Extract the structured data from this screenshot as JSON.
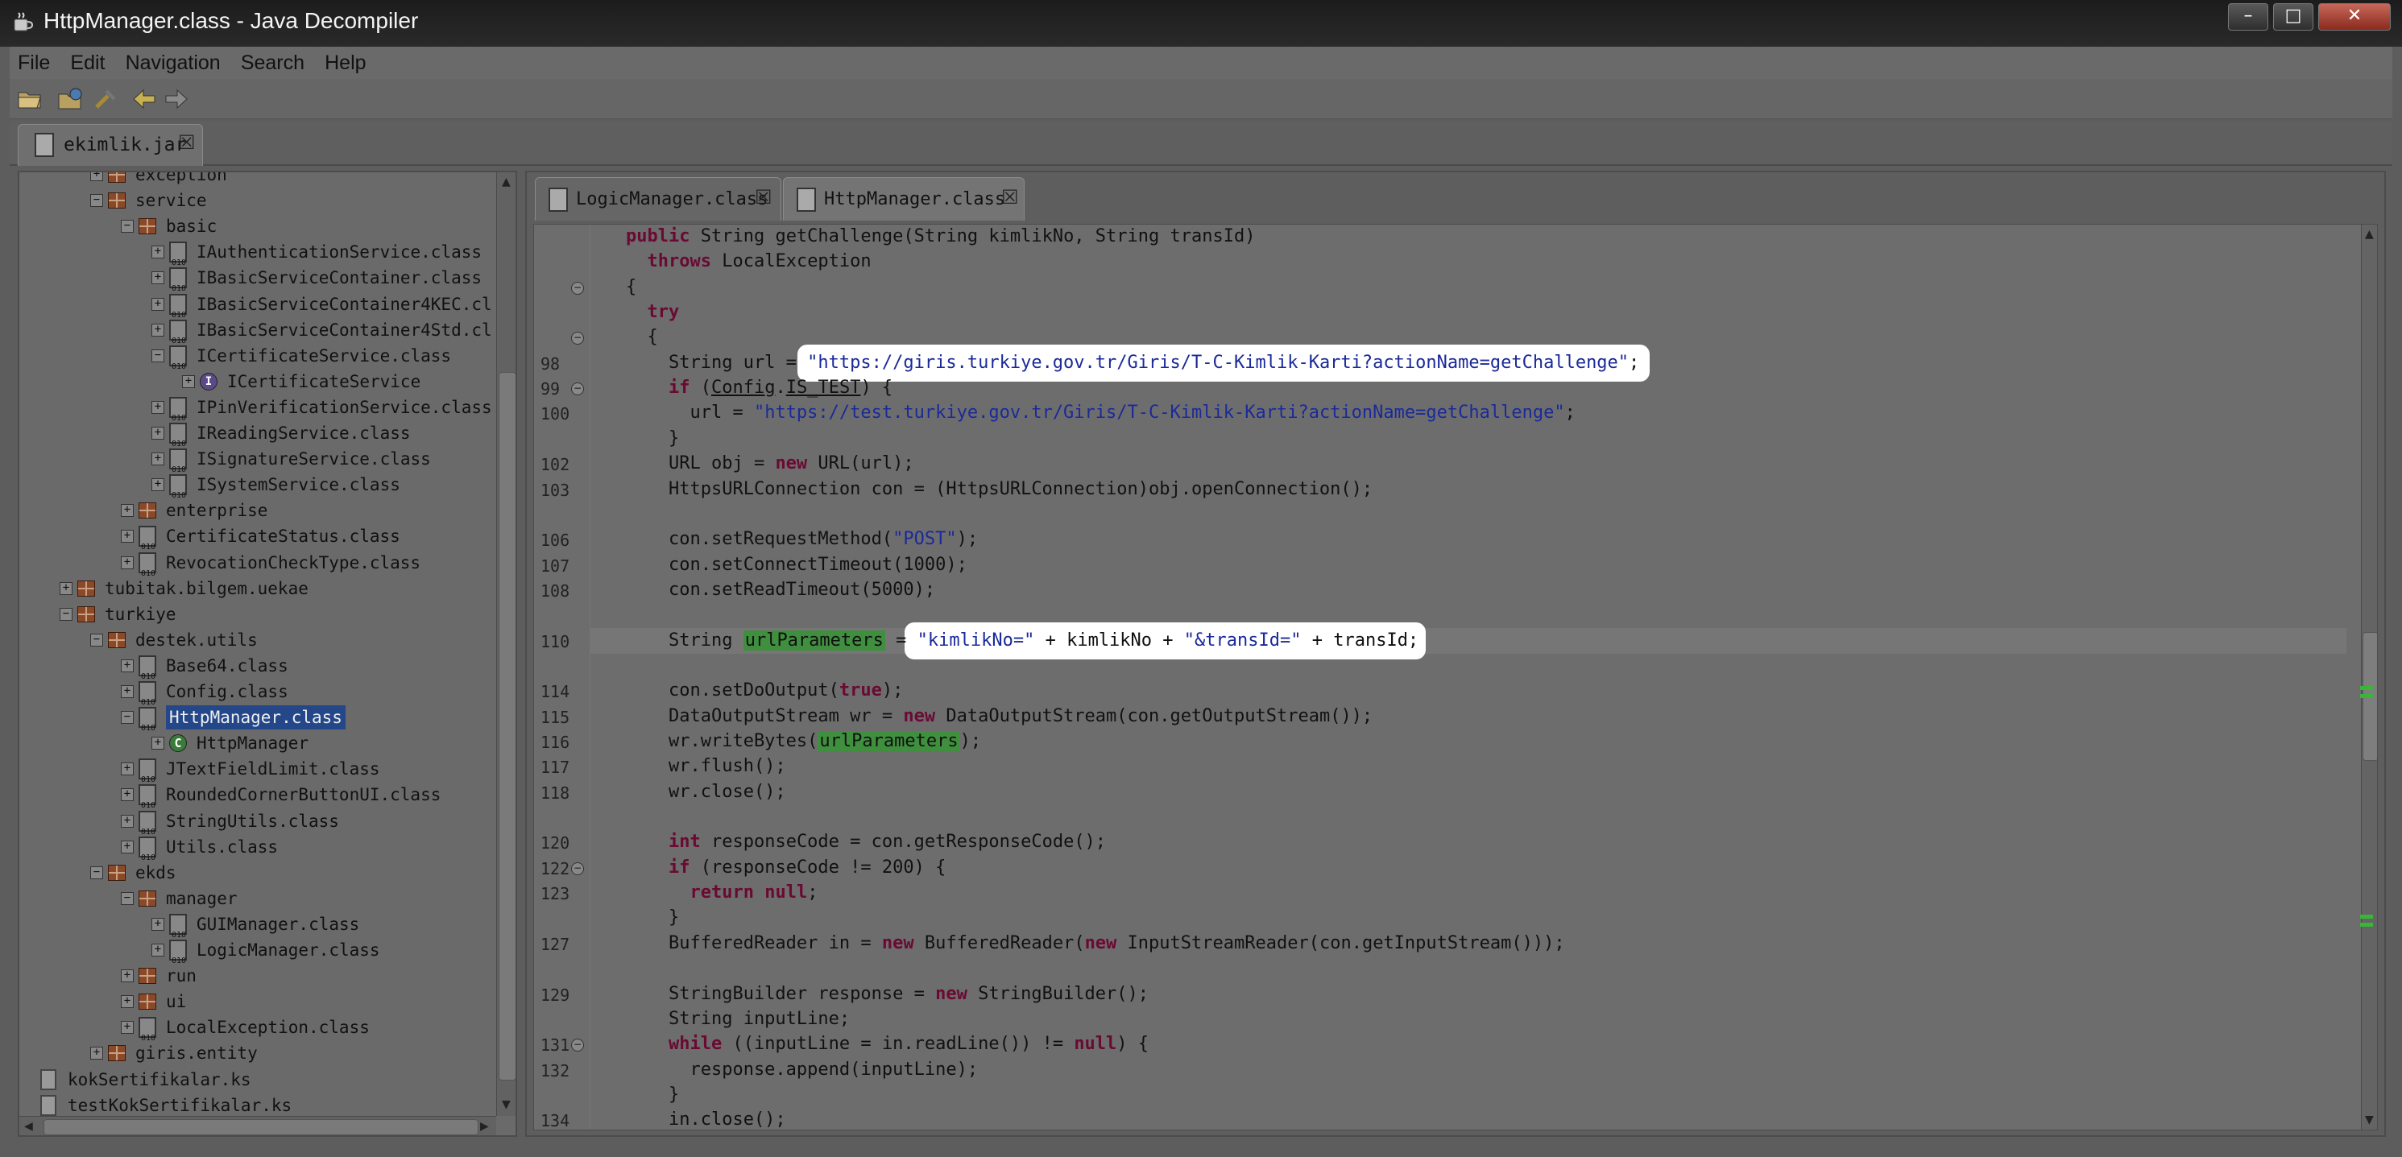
{
  "window": {
    "title": "HttpManager.class - Java Decompiler",
    "minimize_label": "–",
    "maximize_label": "□",
    "close_label": "✕"
  },
  "menu": [
    "File",
    "Edit",
    "Navigation",
    "Search",
    "Help"
  ],
  "toolbar": {
    "icons": [
      "open-file-icon",
      "open-type-icon",
      "refresh-icon",
      "back-arrow-icon",
      "forward-arrow-icon"
    ]
  },
  "jar_tab": {
    "label": "ekimlik.jar",
    "close": "☒"
  },
  "tree": {
    "items": [
      {
        "label": "exception",
        "type": "package",
        "level": 2,
        "expanded": false
      },
      {
        "label": "service",
        "type": "package",
        "level": 2,
        "expanded": true
      },
      {
        "label": "basic",
        "type": "package",
        "level": 3,
        "expanded": true
      },
      {
        "label": "IAuthenticationService.class",
        "type": "class",
        "level": 4
      },
      {
        "label": "IBasicServiceContainer.class",
        "type": "class",
        "level": 4
      },
      {
        "label": "IBasicServiceContainer4KEC.cl",
        "type": "class",
        "level": 4
      },
      {
        "label": "IBasicServiceContainer4Std.cl",
        "type": "class",
        "level": 4
      },
      {
        "label": "ICertificateService.class",
        "type": "class",
        "level": 4,
        "expanded": true
      },
      {
        "label": "ICertificateService",
        "type": "interface",
        "level": 5
      },
      {
        "label": "IPinVerificationService.class",
        "type": "class",
        "level": 4
      },
      {
        "label": "IReadingService.class",
        "type": "class",
        "level": 4
      },
      {
        "label": "ISignatureService.class",
        "type": "class",
        "level": 4
      },
      {
        "label": "ISystemService.class",
        "type": "class",
        "level": 4
      },
      {
        "label": "enterprise",
        "type": "package",
        "level": 3
      },
      {
        "label": "CertificateStatus.class",
        "type": "class",
        "level": 3
      },
      {
        "label": "RevocationCheckType.class",
        "type": "class",
        "level": 3
      },
      {
        "label": "tubitak.bilgem.uekae",
        "type": "package",
        "level": 1
      },
      {
        "label": "turkiye",
        "type": "package",
        "level": 1,
        "expanded": true
      },
      {
        "label": "destek.utils",
        "type": "package",
        "level": 2,
        "expanded": true
      },
      {
        "label": "Base64.class",
        "type": "class",
        "level": 3
      },
      {
        "label": "Config.class",
        "type": "class",
        "level": 3
      },
      {
        "label": "HttpManager.class",
        "type": "class",
        "level": 3,
        "expanded": true,
        "selected": true
      },
      {
        "label": "HttpManager",
        "type": "classnode",
        "level": 4
      },
      {
        "label": "JTextFieldLimit.class",
        "type": "class",
        "level": 3
      },
      {
        "label": "RoundedCornerButtonUI.class",
        "type": "class",
        "level": 3
      },
      {
        "label": "StringUtils.class",
        "type": "class",
        "level": 3
      },
      {
        "label": "Utils.class",
        "type": "class",
        "level": 3
      },
      {
        "label": "ekds",
        "type": "package",
        "level": 2,
        "expanded": true
      },
      {
        "label": "manager",
        "type": "package",
        "level": 3,
        "expanded": true
      },
      {
        "label": "GUIManager.class",
        "type": "class",
        "level": 4
      },
      {
        "label": "LogicManager.class",
        "type": "class",
        "level": 4
      },
      {
        "label": "run",
        "type": "package",
        "level": 3
      },
      {
        "label": "ui",
        "type": "package",
        "level": 3
      },
      {
        "label": "LocalException.class",
        "type": "class",
        "level": 3
      },
      {
        "label": "giris.entity",
        "type": "package",
        "level": 2
      },
      {
        "label": "kokSertifikalar.ks",
        "type": "file",
        "level": 0
      },
      {
        "label": "testKokSertifikalar.ks",
        "type": "file",
        "level": 0
      }
    ]
  },
  "editor_tabs": [
    {
      "label": "LogicManager.class",
      "active": false
    },
    {
      "label": "HttpManager.class",
      "active": true
    }
  ],
  "code": {
    "lines": [
      {
        "n": "",
        "text": "public String getChallenge(String kimlikNo, String transId)"
      },
      {
        "n": "",
        "text": "  throws LocalException"
      },
      {
        "n": "",
        "text": "{",
        "fold": true
      },
      {
        "n": "",
        "text": "  try"
      },
      {
        "n": "",
        "text": "  {",
        "fold": true
      },
      {
        "n": "98",
        "text": "    String url = \"https://giris.turkiye.gov.tr/Giris/T-C-Kimlik-Karti?actionName=getChallenge\";"
      },
      {
        "n": "99",
        "text": "    if (Config.IS_TEST) {",
        "fold": true
      },
      {
        "n": "100",
        "text": "      url = \"https://test.turkiye.gov.tr/Giris/T-C-Kimlik-Karti?actionName=getChallenge\";"
      },
      {
        "n": "",
        "text": "    }"
      },
      {
        "n": "102",
        "text": "    URL obj = new URL(url);"
      },
      {
        "n": "103",
        "text": "    HttpsURLConnection con = (HttpsURLConnection)obj.openConnection();"
      },
      {
        "n": "",
        "text": ""
      },
      {
        "n": "106",
        "text": "    con.setRequestMethod(\"POST\");"
      },
      {
        "n": "107",
        "text": "    con.setConnectTimeout(1000);"
      },
      {
        "n": "108",
        "text": "    con.setReadTimeout(5000);"
      },
      {
        "n": "",
        "text": ""
      },
      {
        "n": "110",
        "text": "    String urlParameters = \"kimlikNo=\" + kimlikNo + \"&transId=\" + transId;"
      },
      {
        "n": "",
        "text": ""
      },
      {
        "n": "114",
        "text": "    con.setDoOutput(true);"
      },
      {
        "n": "115",
        "text": "    DataOutputStream wr = new DataOutputStream(con.getOutputStream());"
      },
      {
        "n": "116",
        "text": "    wr.writeBytes(urlParameters);"
      },
      {
        "n": "117",
        "text": "    wr.flush();"
      },
      {
        "n": "118",
        "text": "    wr.close();"
      },
      {
        "n": "",
        "text": ""
      },
      {
        "n": "120",
        "text": "    int responseCode = con.getResponseCode();"
      },
      {
        "n": "122",
        "text": "    if (responseCode != 200) {",
        "fold": true
      },
      {
        "n": "123",
        "text": "      return null;"
      },
      {
        "n": "",
        "text": "    }"
      },
      {
        "n": "127",
        "text": "    BufferedReader in = new BufferedReader(new InputStreamReader(con.getInputStream()));"
      },
      {
        "n": "",
        "text": ""
      },
      {
        "n": "129",
        "text": "    StringBuilder response = new StringBuilder();"
      },
      {
        "n": "",
        "text": "    String inputLine;"
      },
      {
        "n": "131",
        "text": "    while ((inputLine = in.readLine()) != null) {",
        "fold": true
      },
      {
        "n": "132",
        "text": "      response.append(inputLine);"
      },
      {
        "n": "",
        "text": "    }"
      },
      {
        "n": "134",
        "text": "    in.close();"
      }
    ]
  }
}
